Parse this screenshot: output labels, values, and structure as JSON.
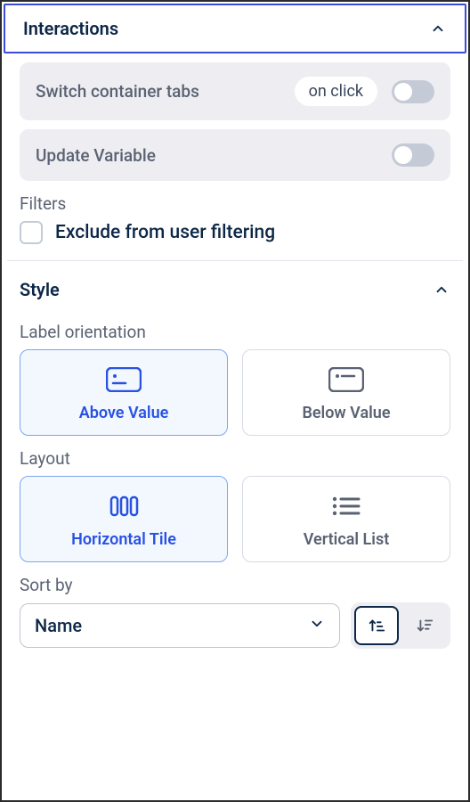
{
  "interactions": {
    "title": "Interactions",
    "rows": [
      {
        "label": "Switch container tabs",
        "pill": "on click",
        "enabled": false
      },
      {
        "label": "Update Variable",
        "enabled": false
      }
    ]
  },
  "filters": {
    "label": "Filters",
    "checkbox_label": "Exclude from user filtering",
    "checked": false
  },
  "style": {
    "title": "Style",
    "label_orientation": {
      "label": "Label orientation",
      "options": [
        {
          "label": "Above Value",
          "selected": true
        },
        {
          "label": "Below Value",
          "selected": false
        }
      ]
    },
    "layout": {
      "label": "Layout",
      "options": [
        {
          "label": "Horizontal Tile",
          "selected": true
        },
        {
          "label": "Vertical List",
          "selected": false
        }
      ]
    },
    "sort_by": {
      "label": "Sort by",
      "selected": "Name",
      "direction": "asc"
    }
  }
}
